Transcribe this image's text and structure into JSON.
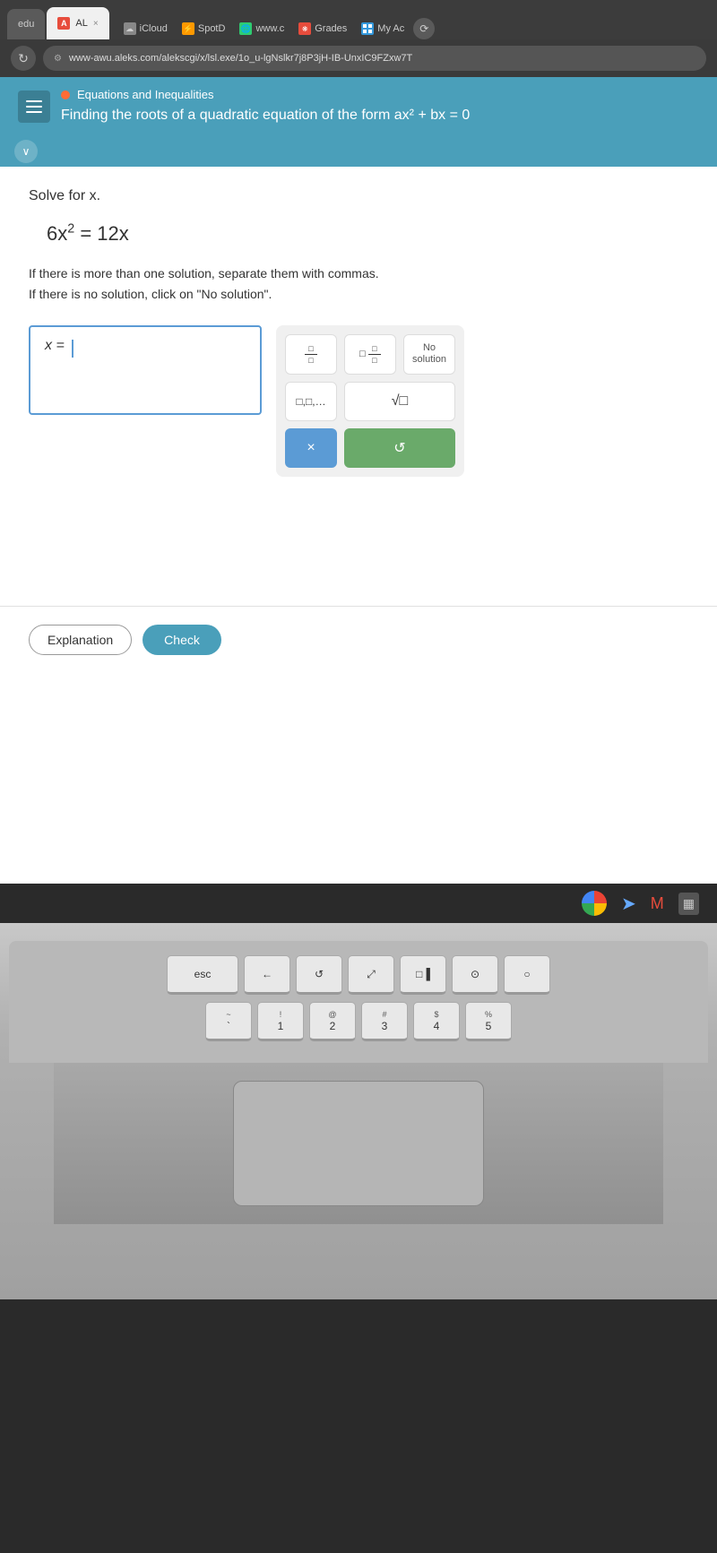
{
  "browser": {
    "tabs": [
      {
        "label": "edu",
        "active": false,
        "favicon_color": "#888"
      },
      {
        "label": "AL",
        "active": true,
        "favicon_color": "#e74c3c",
        "favicon_letter": "A",
        "close_icon": "×"
      },
      {
        "label": "iCloud",
        "active": false
      },
      {
        "label": "SpotD",
        "active": false
      },
      {
        "label": "www.c",
        "active": false
      },
      {
        "label": "Grades",
        "active": false
      },
      {
        "label": "My Ac",
        "active": false
      }
    ],
    "address": "www-awu.aleks.com/alekscgi/x/lsl.exe/1o_u-lgNslkr7j8P3jH-IB-UnxIC9FZxw7T",
    "nav_back": "←",
    "nav_reload": "↻"
  },
  "aleks": {
    "section_label": "Equations and Inequalities",
    "topic_title": "Finding the roots of a quadratic equation of the form ax² + bx = 0",
    "instruction": "Solve for x.",
    "equation": "6x² = 12x",
    "solution_note_line1": "If there is more than one solution, separate them with commas.",
    "solution_note_line2": "If there is no solution, click on \"No solution\".",
    "answer_prefix": "x =",
    "keyboard": {
      "btn_fraction": "fraction",
      "btn_mixed_fraction": "mixed-fraction",
      "btn_no_solution": "No solution",
      "btn_sequence": "sequence",
      "btn_sqrt": "√□",
      "btn_clear": "×",
      "btn_undo": "↺"
    },
    "buttons": {
      "explanation": "Explanation",
      "check": "Check"
    }
  },
  "system_bar": {
    "icons": [
      "chrome",
      "arrow",
      "mail",
      "grid"
    ]
  },
  "keyboard": {
    "rows": [
      [
        {
          "label": "esc",
          "wide": false
        },
        {
          "label": "←",
          "wide": false
        },
        {
          "label": "↺",
          "wide": false
        },
        {
          "label": "⊡",
          "wide": false
        },
        {
          "label": "□▐",
          "wide": false
        },
        {
          "label": "⊙",
          "wide": false
        },
        {
          "label": "○",
          "wide": false
        }
      ],
      [
        {
          "top": "~",
          "main": "`",
          "wide": false
        },
        {
          "top": "!",
          "main": "1",
          "wide": false
        },
        {
          "top": "@",
          "main": "2",
          "wide": false
        },
        {
          "top": "#",
          "main": "3",
          "wide": false
        },
        {
          "top": "$",
          "main": "4",
          "wide": false
        },
        {
          "top": "%",
          "main": "5",
          "wide": false
        }
      ]
    ]
  }
}
